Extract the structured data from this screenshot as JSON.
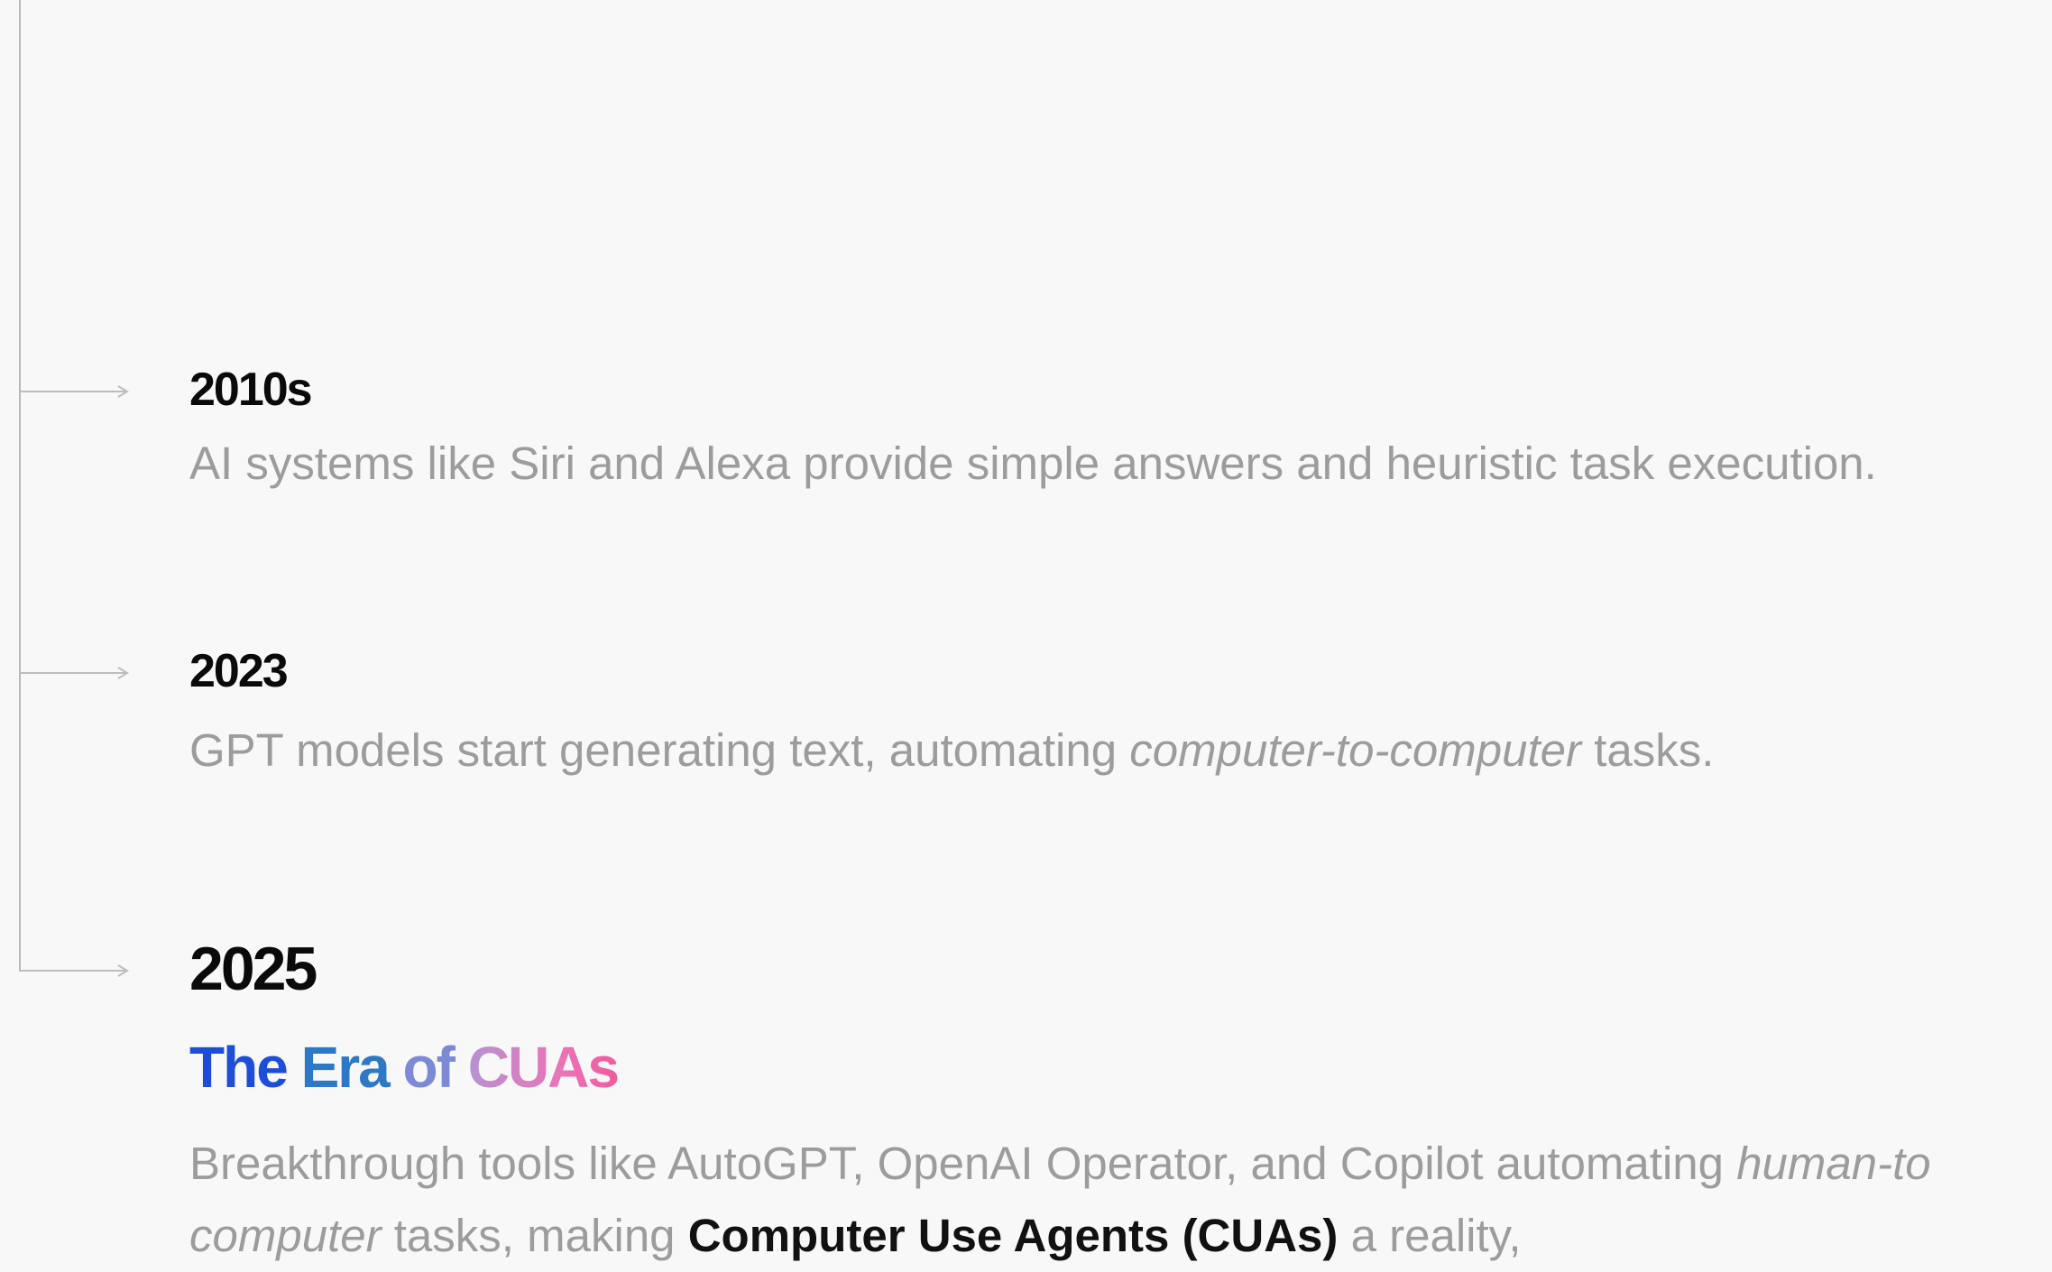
{
  "timeline": {
    "entries": [
      {
        "year": "2010s",
        "description": "AI systems like Siri and Alexa provide simple answers and heuristic task execution."
      },
      {
        "year": "2023",
        "description": {
          "before": "GPT models start generating text, automating ",
          "emphasis": "computer-to-computer",
          "after": " tasks."
        }
      },
      {
        "year": "2025",
        "headline": {
          "word1": "The",
          "word2": "Era",
          "word3": "of",
          "word4": "CUAs"
        },
        "body": {
          "line1_before": "Breakthrough tools like AutoGPT, OpenAI Operator, and Copilot automating ",
          "line1_emphasis": "human-to",
          "line2_emphasis": "computer",
          "line2_middle": " tasks, making ",
          "line2_strong": "Computer Use Agents (CUAs)",
          "line2_after": " a reality,"
        }
      }
    ]
  },
  "colors": {
    "background": "#f8f8f8",
    "timeline_line": "#b9b9b9",
    "year_text": "#0a0a0a",
    "description_text": "#9c9c9c",
    "headline_the": "#1d4ed8",
    "headline_era": "#2d79c7",
    "headline_of": "#7c8ad6",
    "headline_cuas_start": "#b692d4",
    "headline_cuas_end": "#f15b9c"
  },
  "icons": {
    "connector": "arrow-right-icon"
  }
}
